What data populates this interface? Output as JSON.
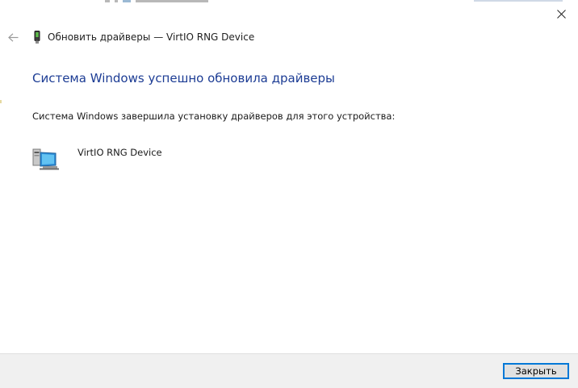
{
  "window": {
    "title": "Обновить драйверы — VirtIO RNG Device"
  },
  "content": {
    "heading": "Система Windows успешно обновила драйверы",
    "description": "Система Windows завершила установку драйверов для этого устройства:",
    "device_name": "VirtIO RNG Device"
  },
  "footer": {
    "close_label": "Закрыть"
  },
  "icons": {
    "close": "close-icon",
    "back": "back-arrow-icon",
    "title": "device-driver-icon",
    "device": "network-device-icon"
  },
  "colors": {
    "heading": "#1c3c94",
    "button_border": "#0078d7",
    "footer_bg": "#f0f0f0"
  }
}
